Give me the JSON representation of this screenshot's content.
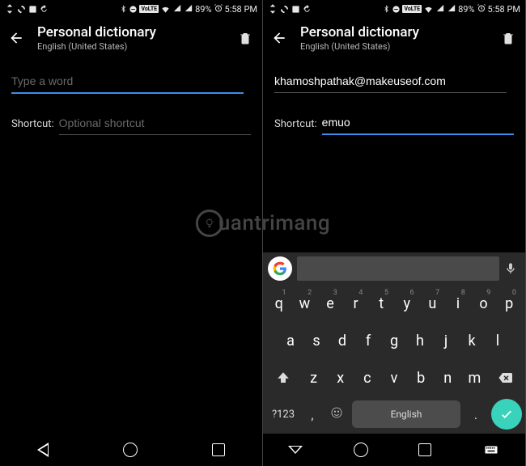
{
  "status": {
    "battery": "89%",
    "time": "5:58 PM",
    "volte": "VoLTE"
  },
  "header": {
    "title": "Personal dictionary",
    "subtitle": "English (United States)"
  },
  "left": {
    "word_value": "",
    "word_placeholder": "Type a word",
    "shortcut_label": "Shortcut:",
    "shortcut_value": "",
    "shortcut_placeholder": "Optional shortcut"
  },
  "right": {
    "word_value": "khamoshpathak@makeuseof.com",
    "word_placeholder": "Type a word",
    "shortcut_label": "Shortcut:",
    "shortcut_value": "emuo",
    "shortcut_placeholder": "Optional shortcut"
  },
  "keyboard": {
    "row1": [
      "q",
      "w",
      "e",
      "r",
      "t",
      "y",
      "u",
      "i",
      "o",
      "p"
    ],
    "hints": [
      "1",
      "2",
      "3",
      "4",
      "5",
      "6",
      "7",
      "8",
      "9",
      "0"
    ],
    "row2": [
      "a",
      "s",
      "d",
      "f",
      "g",
      "h",
      "j",
      "k",
      "l"
    ],
    "row3": [
      "z",
      "x",
      "c",
      "v",
      "b",
      "n",
      "m"
    ],
    "sym": "?123",
    "space": "English",
    "comma": ",",
    "dot": "."
  },
  "watermark": "uantrimang"
}
